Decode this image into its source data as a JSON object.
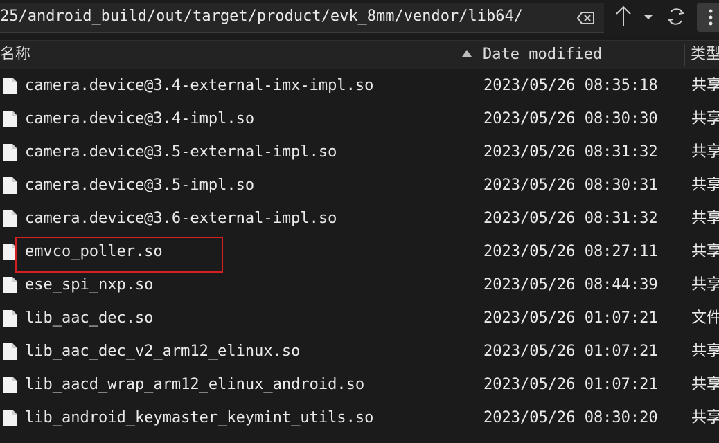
{
  "toolbar": {
    "path": "25/android_build/out/target/product/evk_8mm/vendor/lib64/",
    "icons": [
      "clear-path-icon",
      "up-arrow-icon",
      "chevron-down-icon",
      "refresh-icon",
      "more-vert-icon"
    ]
  },
  "header": {
    "name": "名称",
    "date": "Date modified",
    "type": "类型",
    "sort": "ascending"
  },
  "files": [
    {
      "name": "camera.device@3.4-external-imx-impl.so",
      "date": "2023/05/26 08:35:18",
      "type": "共享"
    },
    {
      "name": "camera.device@3.4-impl.so",
      "date": "2023/05/26 08:30:30",
      "type": "共享"
    },
    {
      "name": "camera.device@3.5-external-impl.so",
      "date": "2023/05/26 08:31:32",
      "type": "共享"
    },
    {
      "name": "camera.device@3.5-impl.so",
      "date": "2023/05/26 08:30:31",
      "type": "共享"
    },
    {
      "name": "camera.device@3.6-external-impl.so",
      "date": "2023/05/26 08:31:32",
      "type": "共享"
    },
    {
      "name": "emvco_poller.so",
      "date": "2023/05/26 08:27:11",
      "type": "共享"
    },
    {
      "name": "ese_spi_nxp.so",
      "date": "2023/05/26 08:44:39",
      "type": "共享"
    },
    {
      "name": "lib_aac_dec.so",
      "date": "2023/05/26 01:07:21",
      "type": "文件"
    },
    {
      "name": "lib_aac_dec_v2_arm12_elinux.so",
      "date": "2023/05/26 01:07:21",
      "type": "共享"
    },
    {
      "name": "lib_aacd_wrap_arm12_elinux_android.so",
      "date": "2023/05/26 01:07:21",
      "type": "共享"
    },
    {
      "name": "lib_android_keymaster_keymint_utils.so",
      "date": "2023/05/26 08:30:20",
      "type": "共享"
    }
  ],
  "highlight_color": "#d42020"
}
